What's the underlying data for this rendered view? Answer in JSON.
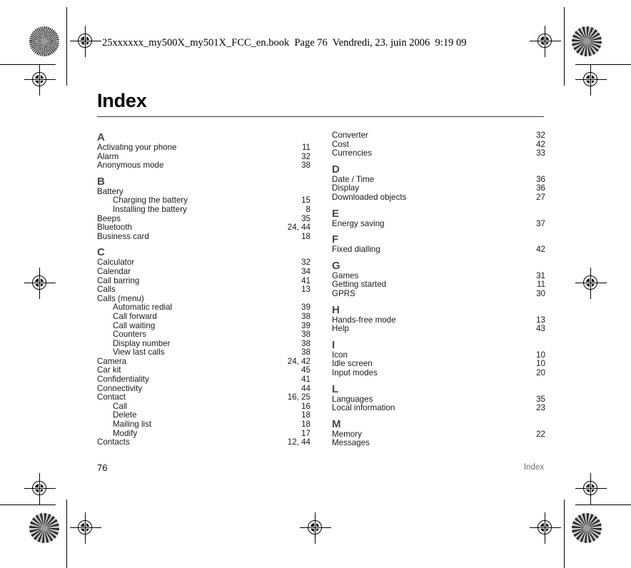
{
  "running_head": "25xxxxxx_my500X_my501X_FCC_en.book  Page 76  Vendredi, 23. juin 2006  9:19 09",
  "page_title": "Index",
  "footer": {
    "folio": "76",
    "label": "Index"
  },
  "columns": [
    {
      "sections": [
        {
          "letter": "A",
          "entries": [
            {
              "label": "Activating your phone",
              "pages": "11",
              "sub": false
            },
            {
              "label": "Alarm",
              "pages": "32",
              "sub": false
            },
            {
              "label": "Anonymous mode",
              "pages": "38",
              "sub": false
            }
          ]
        },
        {
          "letter": "B",
          "entries": [
            {
              "label": "Battery",
              "pages": "",
              "sub": false
            },
            {
              "label": "Charging the battery",
              "pages": "15",
              "sub": true
            },
            {
              "label": "Installing the battery",
              "pages": "8",
              "sub": true
            },
            {
              "label": "Beeps",
              "pages": "35",
              "sub": false
            },
            {
              "label": "Bluetooth",
              "pages": "24, 44",
              "sub": false
            },
            {
              "label": "Business card",
              "pages": "18",
              "sub": false
            }
          ]
        },
        {
          "letter": "C",
          "entries": [
            {
              "label": "Calculator",
              "pages": "32",
              "sub": false
            },
            {
              "label": "Calendar",
              "pages": "34",
              "sub": false
            },
            {
              "label": "Call barring",
              "pages": "41",
              "sub": false
            },
            {
              "label": "Calls",
              "pages": "13",
              "sub": false
            },
            {
              "label": "Calls (menu)",
              "pages": "",
              "sub": false
            },
            {
              "label": "Automatic redial",
              "pages": "39",
              "sub": true
            },
            {
              "label": "Call forward",
              "pages": "38",
              "sub": true
            },
            {
              "label": "Call waiting",
              "pages": "39",
              "sub": true
            },
            {
              "label": "Counters",
              "pages": "38",
              "sub": true
            },
            {
              "label": "Display number",
              "pages": "38",
              "sub": true
            },
            {
              "label": "View last calls",
              "pages": "38",
              "sub": true
            },
            {
              "label": "Camera",
              "pages": "24, 42",
              "sub": false
            },
            {
              "label": "Car kit",
              "pages": "45",
              "sub": false
            },
            {
              "label": "Confidentiality",
              "pages": "41",
              "sub": false
            },
            {
              "label": "Connectivity",
              "pages": "44",
              "sub": false
            },
            {
              "label": "Contact",
              "pages": "16, 25",
              "sub": false
            },
            {
              "label": "Call",
              "pages": "16",
              "sub": true
            },
            {
              "label": "Delete",
              "pages": "18",
              "sub": true
            },
            {
              "label": "Mailing list",
              "pages": "18",
              "sub": true
            },
            {
              "label": "Modify",
              "pages": "17",
              "sub": true
            },
            {
              "label": "Contacts",
              "pages": "12, 44",
              "sub": false
            }
          ]
        }
      ]
    },
    {
      "sections": [
        {
          "letter": "",
          "entries": [
            {
              "label": "Converter",
              "pages": "32",
              "sub": false
            },
            {
              "label": "Cost",
              "pages": "42",
              "sub": false
            },
            {
              "label": "Currencies",
              "pages": "33",
              "sub": false
            }
          ]
        },
        {
          "letter": "D",
          "entries": [
            {
              "label": "Date / Time",
              "pages": "36",
              "sub": false
            },
            {
              "label": "Display",
              "pages": "36",
              "sub": false
            },
            {
              "label": "Downloaded objects",
              "pages": "27",
              "sub": false
            }
          ]
        },
        {
          "letter": "E",
          "entries": [
            {
              "label": "Energy saving",
              "pages": "37",
              "sub": false
            }
          ]
        },
        {
          "letter": "F",
          "entries": [
            {
              "label": "Fixed dialling",
              "pages": "42",
              "sub": false
            }
          ]
        },
        {
          "letter": "G",
          "entries": [
            {
              "label": "Games",
              "pages": "31",
              "sub": false
            },
            {
              "label": "Getting started",
              "pages": "11",
              "sub": false
            },
            {
              "label": "GPRS",
              "pages": "30",
              "sub": false
            }
          ]
        },
        {
          "letter": "H",
          "entries": [
            {
              "label": "Hands-free mode",
              "pages": "13",
              "sub": false
            },
            {
              "label": "Help",
              "pages": "43",
              "sub": false
            }
          ]
        },
        {
          "letter": "I",
          "entries": [
            {
              "label": "Icon",
              "pages": "10",
              "sub": false
            },
            {
              "label": "Idle screen",
              "pages": "10",
              "sub": false
            },
            {
              "label": "Input modes",
              "pages": "20",
              "sub": false
            }
          ]
        },
        {
          "letter": "L",
          "entries": [
            {
              "label": "Languages",
              "pages": "35",
              "sub": false
            },
            {
              "label": "Local information",
              "pages": "23",
              "sub": false
            }
          ]
        },
        {
          "letter": "M",
          "entries": [
            {
              "label": "Memory",
              "pages": "22",
              "sub": false
            },
            {
              "label": "Messages",
              "pages": "",
              "sub": false
            }
          ]
        }
      ]
    }
  ]
}
